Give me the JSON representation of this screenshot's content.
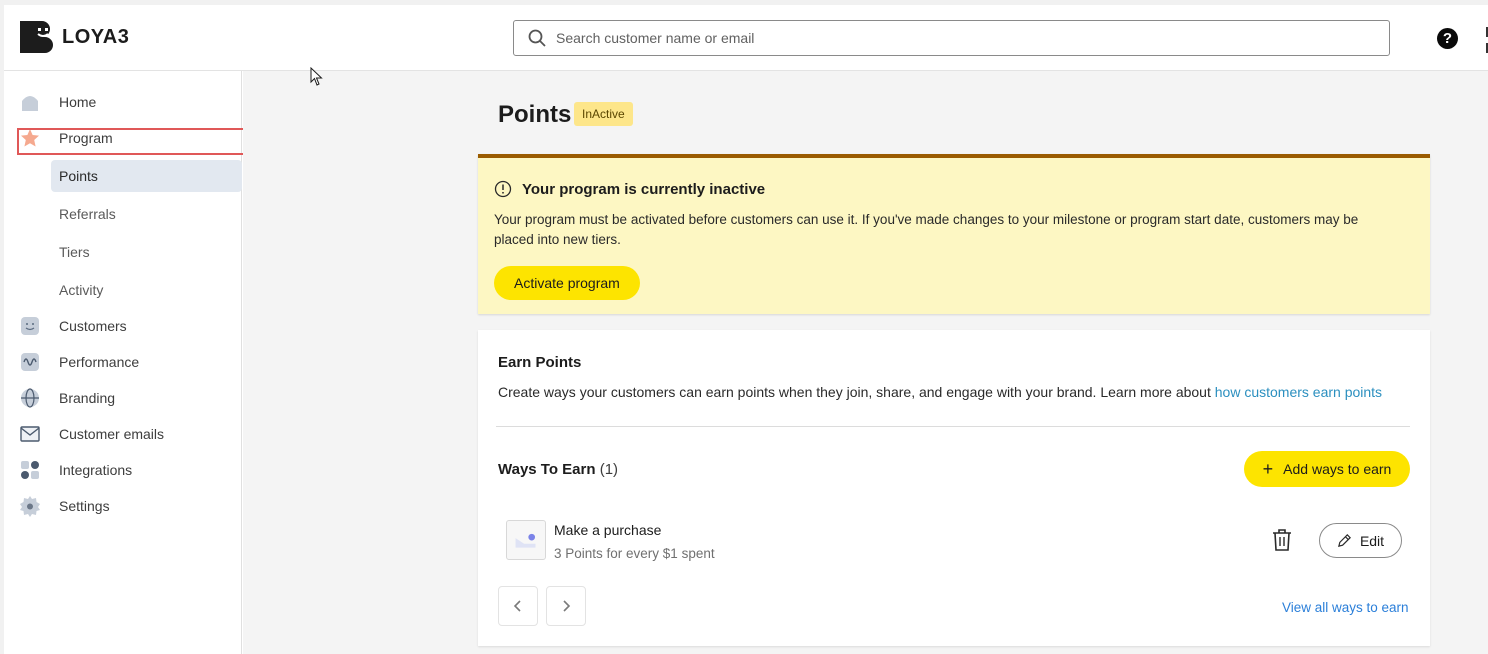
{
  "brand": {
    "name": "LOYA3"
  },
  "search": {
    "placeholder": "Search customer name or email"
  },
  "help": {
    "glyph": "?"
  },
  "sidebar": {
    "items": [
      {
        "label": "Home",
        "icon": "home-icon"
      },
      {
        "label": "Program",
        "icon": "star-icon"
      },
      {
        "label": "Customers",
        "icon": "smiley-icon"
      },
      {
        "label": "Performance",
        "icon": "wave-icon"
      },
      {
        "label": "Branding",
        "icon": "globe-icon"
      },
      {
        "label": "Customer emails",
        "icon": "mail-icon"
      },
      {
        "label": "Integrations",
        "icon": "grid-icon"
      },
      {
        "label": "Settings",
        "icon": "gear-icon"
      }
    ],
    "sub_items": [
      {
        "label": "Points",
        "active": true
      },
      {
        "label": "Referrals",
        "active": false
      },
      {
        "label": "Tiers",
        "active": false
      },
      {
        "label": "Activity",
        "active": false
      }
    ]
  },
  "page": {
    "title": "Points",
    "status_badge": "InActive"
  },
  "alert": {
    "title": "Your program is currently inactive",
    "body": "Your program must be activated before customers can use it. If you've made changes to your milestone or program start date, customers may be placed into new tiers.",
    "button": "Activate program"
  },
  "earn": {
    "title": "Earn Points",
    "description": "Create ways your customers can earn points when they join, share, and engage with your brand. Learn more about",
    "link": "how customers earn points",
    "ways_title": "Ways To Earn",
    "ways_count": "(1)",
    "add_button": "Add ways to earn",
    "ways": [
      {
        "name": "Make a purchase",
        "detail": "3 Points for every $1 spent",
        "edit_label": "Edit"
      }
    ],
    "view_all": "View all ways to earn"
  },
  "colors": {
    "accent_yellow": "#fde400",
    "alert_bg": "#fdf7c3",
    "alert_border": "#9a5b00",
    "badge_bg": "#fde68a",
    "link_blue": "#2b7fd9",
    "highlight_red": "#e05858"
  }
}
